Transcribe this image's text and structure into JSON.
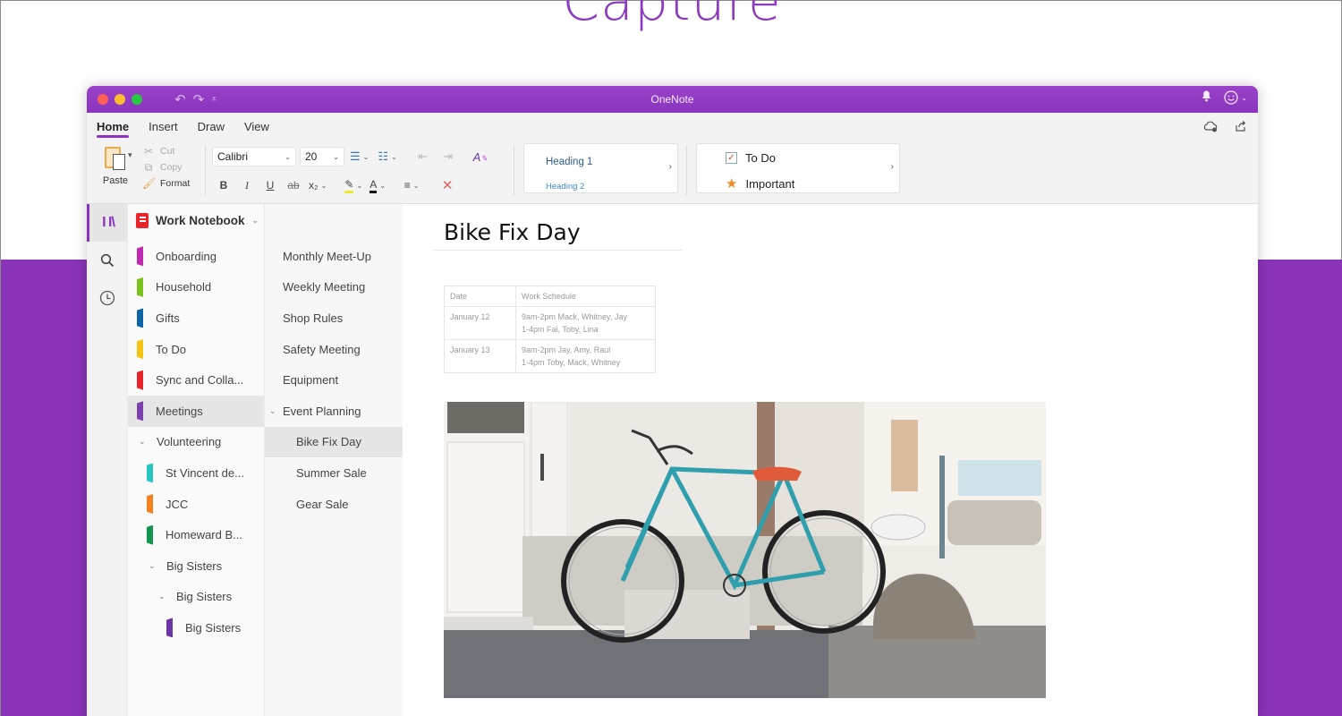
{
  "hero": {
    "title": "Capture"
  },
  "colors": {
    "brand": "#8a34bd",
    "band": "#8a33b8",
    "hero_text": "#8c3bbf"
  },
  "window": {
    "title": "OneNote",
    "quick_access": [
      "undo-icon",
      "redo-icon",
      "customize-icon"
    ],
    "titlebar_right": [
      "bell-icon",
      "feedback-smiley-icon"
    ]
  },
  "ribbon": {
    "tabs": [
      {
        "label": "Home",
        "active": true
      },
      {
        "label": "Insert",
        "active": false
      },
      {
        "label": "Draw",
        "active": false
      },
      {
        "label": "View",
        "active": false
      }
    ],
    "right_icons": [
      "sync-cloud-icon",
      "share-icon"
    ],
    "clipboard": {
      "paste": "Paste",
      "cut": "Cut",
      "copy": "Copy",
      "format": "Format"
    },
    "font": {
      "family": "Calibri",
      "size": "20"
    },
    "format_buttons": {
      "bold": "B",
      "italic": "I",
      "underline": "U",
      "strike": "ab",
      "subscript": "x₂"
    },
    "styles": {
      "heading1": "Heading 1",
      "heading2": "Heading 2"
    },
    "tags": {
      "todo": "To Do",
      "important": "Important"
    }
  },
  "notebook": {
    "name": "Work Notebook",
    "sections": [
      {
        "label": "Onboarding",
        "color": "#c02ab0",
        "indent": 0,
        "type": "section"
      },
      {
        "label": "Household",
        "color": "#7ac21e",
        "indent": 0,
        "type": "section"
      },
      {
        "label": "Gifts",
        "color": "#0f63a8",
        "indent": 0,
        "type": "section"
      },
      {
        "label": "To Do",
        "color": "#f5c316",
        "indent": 0,
        "type": "section"
      },
      {
        "label": "Sync and Colla...",
        "color": "#e8262a",
        "indent": 0,
        "type": "section"
      },
      {
        "label": "Meetings",
        "color": "#7c3fae",
        "indent": 0,
        "type": "section",
        "active": true
      },
      {
        "label": "Volunteering",
        "indent": 0,
        "type": "group"
      },
      {
        "label": "St Vincent de...",
        "color": "#28c6c0",
        "indent": 1,
        "type": "section"
      },
      {
        "label": "JCC",
        "color": "#f5811f",
        "indent": 1,
        "type": "section"
      },
      {
        "label": "Homeward B...",
        "color": "#13944c",
        "indent": 1,
        "type": "section"
      },
      {
        "label": "Big Sisters",
        "indent": 1,
        "type": "group"
      },
      {
        "label": "Big Sisters",
        "indent": 2,
        "type": "group"
      },
      {
        "label": "Big Sisters",
        "color": "#6b35a8",
        "indent": 3,
        "type": "section"
      }
    ],
    "pages": [
      {
        "label": "Monthly Meet-Up"
      },
      {
        "label": "Weekly Meeting"
      },
      {
        "label": "Shop Rules"
      },
      {
        "label": "Safety Meeting"
      },
      {
        "label": "Equipment"
      },
      {
        "label": "Event Planning",
        "expanded": true
      },
      {
        "label": "Bike Fix Day",
        "sub": true,
        "active": true
      },
      {
        "label": "Summer Sale",
        "sub": true
      },
      {
        "label": "Gear Sale",
        "sub": true
      }
    ]
  },
  "nav_rail": [
    "notebooks-icon",
    "search-icon",
    "recent-clock-icon"
  ],
  "page": {
    "title": "Bike Fix Day",
    "table": {
      "headers": [
        "Date",
        "Work Schedule"
      ],
      "rows": [
        {
          "date": "January 12",
          "lines": [
            "9am-2pm Mack, Whitney, Jay",
            "1-4pm Fai, Toby, Lina"
          ]
        },
        {
          "date": "January 13",
          "lines": [
            "9am-2pm Jay, Amy, Raul",
            "1-4pm Toby, Mack, Whitney"
          ]
        }
      ]
    },
    "image": {
      "subject": "teal bicycle leaning against a white building wall"
    }
  }
}
